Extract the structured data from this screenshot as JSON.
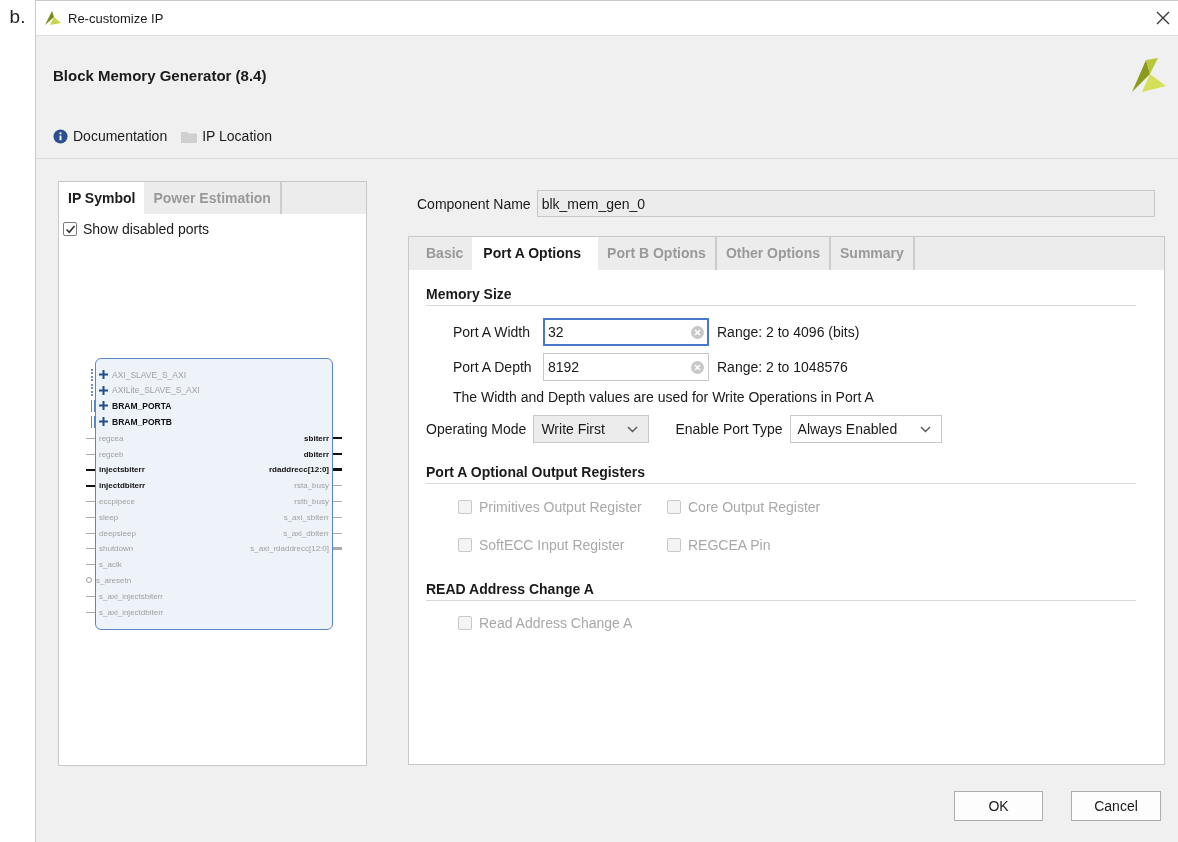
{
  "label": "b.",
  "window": {
    "title": "Re-customize IP"
  },
  "header": {
    "title": "Block Memory Generator (8.4)",
    "links": [
      {
        "label": "Documentation",
        "kind": "info"
      },
      {
        "label": "IP Location",
        "kind": "folder"
      }
    ]
  },
  "left_tabs": [
    {
      "label": "IP Symbol",
      "selected": true
    },
    {
      "label": "Power Estimation",
      "selected": false
    }
  ],
  "show_disabled_ports": {
    "label": "Show disabled ports",
    "checked": true
  },
  "symbol": {
    "interfaces": [
      {
        "name": "AXI_SLAVE_S_AXI",
        "enabled": false
      },
      {
        "name": "AXILite_SLAVE_S_AXI",
        "enabled": false
      },
      {
        "name": "BRAM_PORTA",
        "enabled": true
      },
      {
        "name": "BRAM_PORTB",
        "enabled": true
      }
    ],
    "left_ports": [
      {
        "name": "regcea",
        "enabled": false,
        "kind": "bit"
      },
      {
        "name": "regceb",
        "enabled": false,
        "kind": "bit"
      },
      {
        "name": "injectsbiterr",
        "enabled": true,
        "kind": "bit"
      },
      {
        "name": "injectdbiterr",
        "enabled": true,
        "kind": "bit"
      },
      {
        "name": "eccpipece",
        "enabled": false,
        "kind": "bit"
      },
      {
        "name": "sleep",
        "enabled": false,
        "kind": "bit"
      },
      {
        "name": "deepsleep",
        "enabled": false,
        "kind": "bit"
      },
      {
        "name": "shutdown",
        "enabled": false,
        "kind": "bit"
      },
      {
        "name": "s_aclk",
        "enabled": false,
        "kind": "bit"
      },
      {
        "name": "s_aresetn",
        "enabled": false,
        "kind": "inverted"
      },
      {
        "name": "s_axi_injectsbiterr",
        "enabled": false,
        "kind": "bit"
      },
      {
        "name": "s_axi_injectdbiterr",
        "enabled": false,
        "kind": "bit"
      }
    ],
    "right_ports": [
      {
        "name": "sbiterr",
        "enabled": true,
        "kind": "bit"
      },
      {
        "name": "dbiterr",
        "enabled": true,
        "kind": "bit"
      },
      {
        "name": "rdaddrecc[12:0]",
        "enabled": true,
        "kind": "bus"
      },
      {
        "name": "rsta_busy",
        "enabled": false,
        "kind": "bit"
      },
      {
        "name": "rstb_busy",
        "enabled": false,
        "kind": "bit"
      },
      {
        "name": "s_axi_sbiterr",
        "enabled": false,
        "kind": "bit"
      },
      {
        "name": "s_axi_dbiterr",
        "enabled": false,
        "kind": "bit"
      },
      {
        "name": "s_axi_rdaddrecc[12:0]",
        "enabled": false,
        "kind": "bus"
      }
    ]
  },
  "component_name": {
    "label": "Component Name",
    "value": "blk_mem_gen_0"
  },
  "tabs": [
    {
      "label": "Basic",
      "selected": false
    },
    {
      "label": "Port A Options",
      "selected": true
    },
    {
      "label": "Port B Options",
      "selected": false
    },
    {
      "label": "Other Options",
      "selected": false
    },
    {
      "label": "Summary",
      "selected": false
    }
  ],
  "memory_size": {
    "title": "Memory Size",
    "fields": [
      {
        "label": "Port A Width",
        "value": "32",
        "focused": true,
        "range": "Range: 2 to 4096 (bits)"
      },
      {
        "label": "Port A Depth",
        "value": "8192",
        "focused": false,
        "range": "Range: 2 to 1048576"
      }
    ],
    "note": "The Width and Depth values are used for Write Operations in Port A",
    "selects": [
      {
        "label": "Operating Mode",
        "value": "Write First",
        "disabled": true
      },
      {
        "label": "Enable Port Type",
        "value": "Always Enabled",
        "disabled": false
      }
    ]
  },
  "output_registers": {
    "title": "Port A Optional Output Registers",
    "options": [
      {
        "label": "Primitives Output Register",
        "checked": false,
        "disabled": true
      },
      {
        "label": "Core Output Register",
        "checked": false,
        "disabled": true
      },
      {
        "label": "SoftECC Input Register",
        "checked": false,
        "disabled": true
      },
      {
        "label": "REGCEA Pin",
        "checked": false,
        "disabled": true
      }
    ]
  },
  "read_address": {
    "title": "READ Address Change A",
    "options": [
      {
        "label": "Read Address Change A",
        "checked": false,
        "disabled": true
      }
    ]
  },
  "buttons": [
    {
      "label": "OK"
    },
    {
      "label": "Cancel"
    }
  ]
}
